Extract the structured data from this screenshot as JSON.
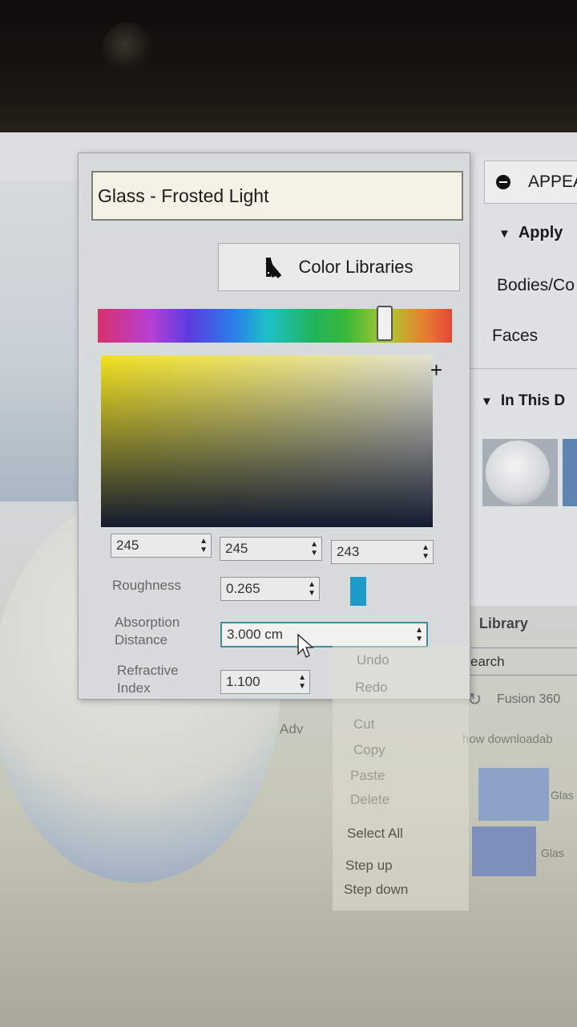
{
  "material_editor": {
    "name": "Glass - Frosted Light",
    "color_libraries_label": "Color Libraries",
    "rgb": {
      "r": "245",
      "g": "245",
      "b": "243"
    },
    "hue_position": 0.81,
    "roughness": {
      "label": "Roughness",
      "value": "0.265"
    },
    "absorption": {
      "label_line1": "Absorption",
      "label_line2": "Distance",
      "value": "3.000 cm"
    },
    "refractive": {
      "label_line1": "Refractive",
      "label_line2": "Index",
      "value": "1.100"
    },
    "advanced_label": "Adv"
  },
  "context_menu": {
    "items": [
      {
        "label": "Undo",
        "enabled": false
      },
      {
        "label": "Redo",
        "enabled": false
      },
      {
        "label": "Cut",
        "enabled": false
      },
      {
        "label": "Copy",
        "enabled": false
      },
      {
        "label": "Paste",
        "enabled": false
      },
      {
        "label": "Delete",
        "enabled": false
      },
      {
        "label": "Select All",
        "enabled": true
      },
      {
        "label": "Step up",
        "enabled": true
      },
      {
        "label": "Step down",
        "enabled": true
      }
    ]
  },
  "appearance_panel": {
    "title": "APPEA",
    "apply_section": "Apply",
    "bodies_label": "Bodies/Co",
    "faces_label": "Faces",
    "in_this_design": "In This D",
    "library_section": "Library",
    "search_text": "earch",
    "library_source": "Fusion 360",
    "show_downloadable": "how downloadab",
    "lib_item1": "Glas",
    "lib_item2": "Glas"
  },
  "colors": {
    "accent_swatch": "#1e9ac8",
    "panel_bg": "#d8dbdc",
    "name_field_bg": "#f4f2e6"
  }
}
